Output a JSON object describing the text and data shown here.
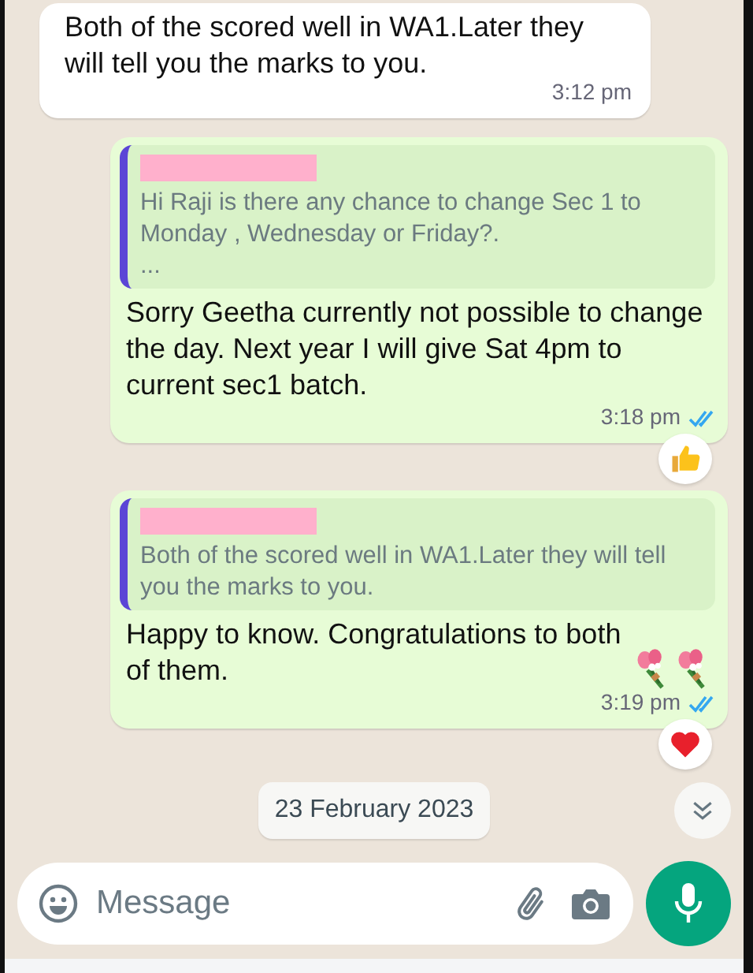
{
  "messages": [
    {
      "kind": "incoming",
      "text": "Both of the scored well in WA1.Later they will tell you the marks to you.",
      "time": "3:12 pm"
    },
    {
      "kind": "outgoing",
      "quote": {
        "sender_hidden": true,
        "text": "Hi Raji is there any chance to change Sec 1 to Monday , Wednesday or Friday?.",
        "more": "..."
      },
      "text": "Sorry Geetha currently not possible to change the day. Next year I will give Sat 4pm to current sec1 batch.",
      "time": "3:18 pm",
      "read": true,
      "reaction": {
        "kind": "thumbs-up"
      }
    },
    {
      "kind": "outgoing",
      "quote": {
        "sender_hidden": true,
        "text": "Both of the scored well in WA1.Later they will tell you the marks to you."
      },
      "text": "Happy to know. Congratulations to both of them.",
      "emoji": [
        {
          "kind": "bouquet"
        },
        {
          "kind": "bouquet"
        }
      ],
      "time": "3:19 pm",
      "read": true,
      "reaction": {
        "kind": "heart"
      }
    }
  ],
  "date_chip": "23 February 2023",
  "composer": {
    "placeholder": "Message"
  }
}
